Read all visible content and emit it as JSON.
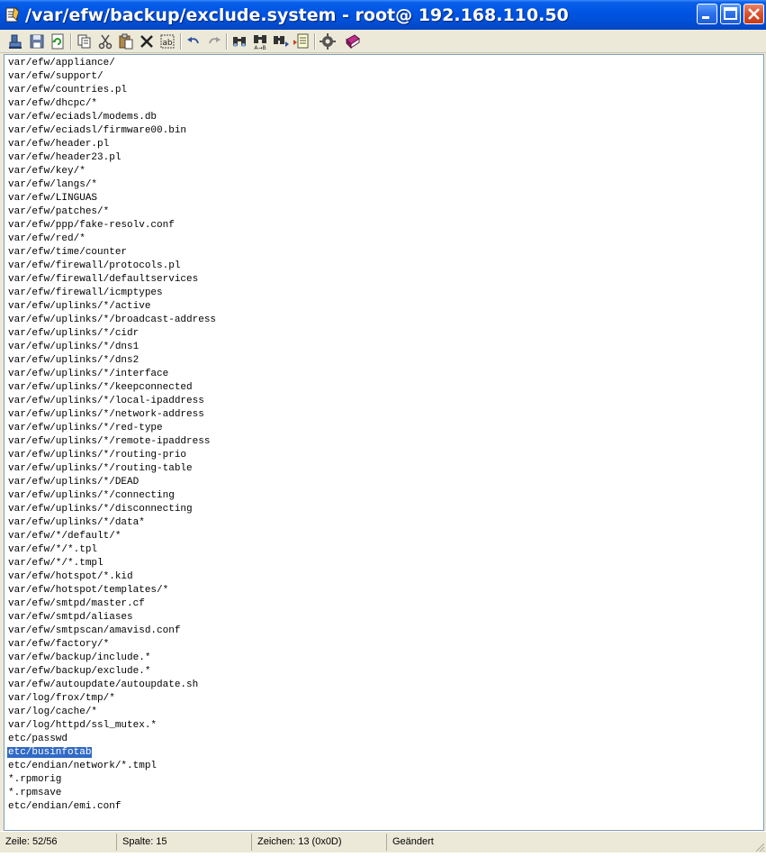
{
  "window": {
    "title": "/var/efw/backup/exclude.system - root@ 192.168.110.50"
  },
  "toolbar": {
    "buttons": [
      "open-remote-icon",
      "save-icon",
      "refresh-icon",
      "copy-icon",
      "cut-icon",
      "paste-icon",
      "delete-icon",
      "select-all-icon",
      "undo-icon",
      "redo-icon",
      "find-icon",
      "find-next-icon",
      "replace-icon",
      "goto-line-icon",
      "settings-icon",
      "help-book-icon"
    ]
  },
  "editor": {
    "selected_line": 52,
    "lines": [
      "var/efw/appliance/",
      "var/efw/support/",
      "var/efw/countries.pl",
      "var/efw/dhcpc/*",
      "var/efw/eciadsl/modems.db",
      "var/efw/eciadsl/firmware00.bin",
      "var/efw/header.pl",
      "var/efw/header23.pl",
      "var/efw/key/*",
      "var/efw/langs/*",
      "var/efw/LINGUAS",
      "var/efw/patches/*",
      "var/efw/ppp/fake-resolv.conf",
      "var/efw/red/*",
      "var/efw/time/counter",
      "var/efw/firewall/protocols.pl",
      "var/efw/firewall/defaultservices",
      "var/efw/firewall/icmptypes",
      "var/efw/uplinks/*/active",
      "var/efw/uplinks/*/broadcast-address",
      "var/efw/uplinks/*/cidr",
      "var/efw/uplinks/*/dns1",
      "var/efw/uplinks/*/dns2",
      "var/efw/uplinks/*/interface",
      "var/efw/uplinks/*/keepconnected",
      "var/efw/uplinks/*/local-ipaddress",
      "var/efw/uplinks/*/network-address",
      "var/efw/uplinks/*/red-type",
      "var/efw/uplinks/*/remote-ipaddress",
      "var/efw/uplinks/*/routing-prio",
      "var/efw/uplinks/*/routing-table",
      "var/efw/uplinks/*/DEAD",
      "var/efw/uplinks/*/connecting",
      "var/efw/uplinks/*/disconnecting",
      "var/efw/uplinks/*/data*",
      "var/efw/*/default/*",
      "var/efw/*/*.tpl",
      "var/efw/*/*.tmpl",
      "var/efw/hotspot/*.kid",
      "var/efw/hotspot/templates/*",
      "var/efw/smtpd/master.cf",
      "var/efw/smtpd/aliases",
      "var/efw/smtpscan/amavisd.conf",
      "var/efw/factory/*",
      "var/efw/backup/include.*",
      "var/efw/backup/exclude.*",
      "var/efw/autoupdate/autoupdate.sh",
      "var/log/frox/tmp/*",
      "var/log/cache/*",
      "var/log/httpd/ssl_mutex.*",
      "etc/passwd",
      "etc/businfotab",
      "etc/endian/network/*.tmpl",
      "*.rpmorig",
      "*.rpmsave",
      "etc/endian/emi.conf"
    ]
  },
  "statusbar": {
    "line": "Zeile: 52/56",
    "column": "Spalte: 15",
    "char": "Zeichen: 13 (0x0D)",
    "state": "Geändert"
  }
}
